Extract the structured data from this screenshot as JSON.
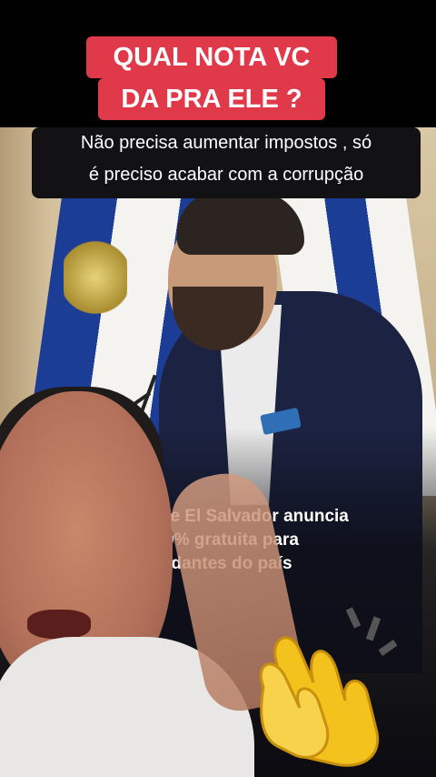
{
  "caption": {
    "line1": "QUAL NOTA VC",
    "line2": "DA PRA ELE ?"
  },
  "subtitle": {
    "line1": "Não precisa aumentar impostos , só",
    "line2": "é preciso acabar com a corrupção"
  },
  "headline": {
    "line1": "e de El Salvador anuncia",
    "line2": "100% gratuita para",
    "line3": "studantes do país"
  },
  "icons": {
    "clap": "clapping-hands-emoji"
  },
  "colors": {
    "caption_bg": "#e03a4a",
    "subtitle_bg": "#121215",
    "flag_blue": "#1b3d96"
  }
}
